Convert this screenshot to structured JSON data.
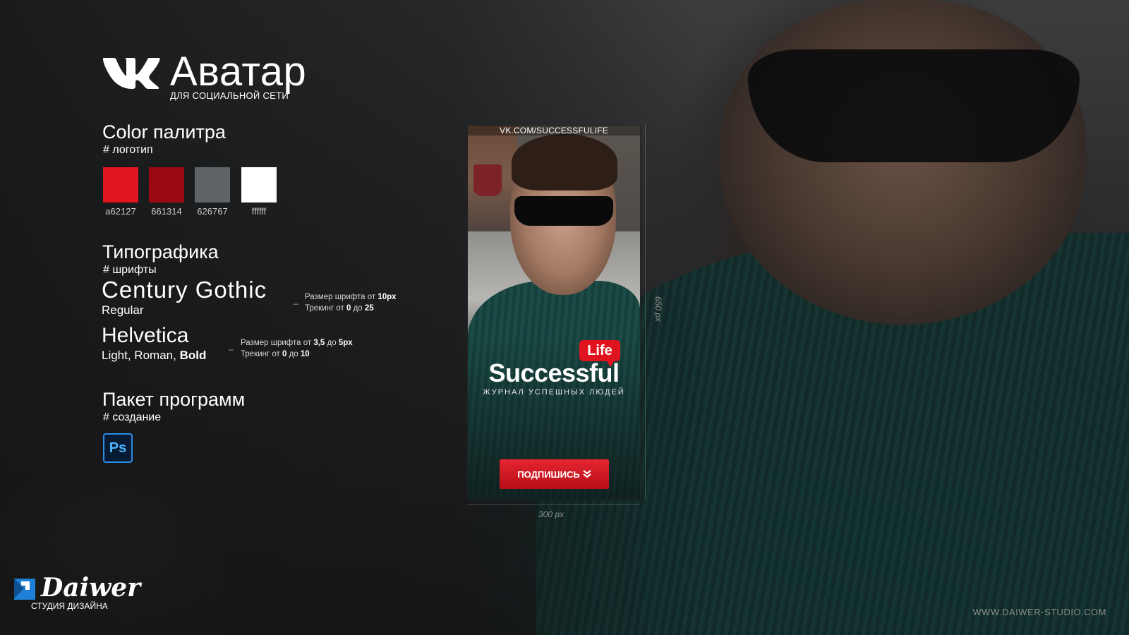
{
  "header": {
    "title": "Аватар",
    "subtitle": "ДЛЯ СОЦИАЛЬНОЙ СЕТИ"
  },
  "colors": {
    "title": "Color палитра",
    "tag": "# логотип",
    "swatches": [
      {
        "label": "a62127",
        "hex": "#e2141f"
      },
      {
        "label": "661314",
        "hex": "#9a0a10"
      },
      {
        "label": "626767",
        "hex": "#5f6566"
      },
      {
        "label": "ffffff",
        "hex": "#ffffff"
      }
    ]
  },
  "typography": {
    "title": "Типографика",
    "tag": "# шрифты",
    "font1": {
      "name": "Century Gothic",
      "style": "Regular",
      "size_prefix": "Размер шрифта от ",
      "size_value": "10px",
      "tracking_prefix": "Трекинг от ",
      "tracking_from": "0",
      "tracking_mid": " до ",
      "tracking_to": "25"
    },
    "font2": {
      "name": "Helvetica",
      "style_light_roman": "Light, Roman, ",
      "style_bold": "Bold",
      "size_prefix": "Размер шрифта от ",
      "size_from": "3,5",
      "size_mid": " до ",
      "size_to": "5px",
      "tracking_prefix": "Трекинг от ",
      "tracking_from": "0",
      "tracking_mid": " до ",
      "tracking_to": "10"
    },
    "dash": "_"
  },
  "software": {
    "title": "Пакет программ",
    "tag": "# создание",
    "icon": "photoshop-icon",
    "icon_text": "Ps"
  },
  "avatar": {
    "url": "VK.COM/SUCCESSFULIFE",
    "badge": "Life",
    "brand": "Successful",
    "tagline": "ЖУРНАЛ УСПЕШНЫХ ЛЮДЕЙ",
    "button": "ПОДПИШИСЬ",
    "height_label": "650 px",
    "width_label": "300 px"
  },
  "footer": {
    "studio": "Daiwer",
    "studio_sub": "СТУДИЯ ДИЗАЙНА",
    "website": "WWW.DAIWER-STUDIO.COM"
  }
}
